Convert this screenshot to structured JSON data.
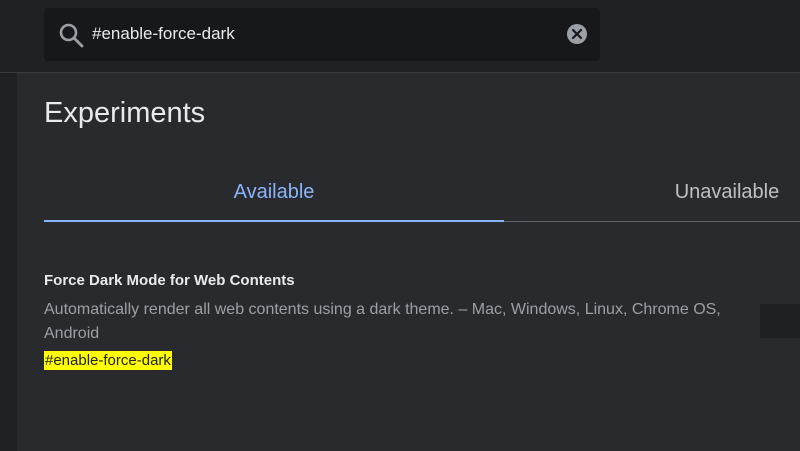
{
  "search": {
    "value": "#enable-force-dark",
    "icon": "search-icon",
    "clear_icon": "close-circle-icon"
  },
  "page": {
    "title": "Experiments"
  },
  "tabs": [
    {
      "label": "Available",
      "selected": true
    },
    {
      "label": "Unavailable",
      "selected": false
    }
  ],
  "experiment": {
    "title": "Force Dark Mode for Web Contents",
    "description": "Automatically render all web contents using a dark theme. – Mac, Windows, Linux, Chrome OS, Android",
    "link": "#enable-force-dark"
  },
  "colors": {
    "background": "#292a2d",
    "topbar": "#202124",
    "accent": "#8ab4f8",
    "highlight": "#ffff00"
  }
}
